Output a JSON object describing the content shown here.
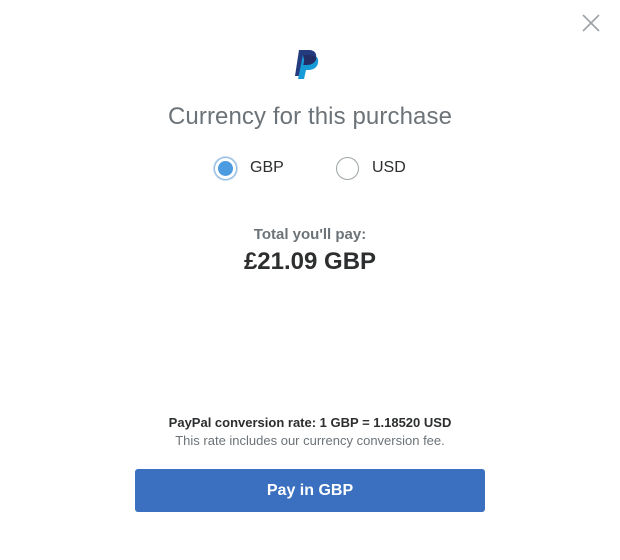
{
  "dialog": {
    "logo_icon": "paypal-logo-icon",
    "close_icon": "close-icon",
    "title": "Currency for this purchase",
    "currency_options": [
      {
        "label": "GBP",
        "selected": true
      },
      {
        "label": "USD",
        "selected": false
      }
    ],
    "total_label": "Total you'll pay:",
    "total_amount": "£21.09 GBP",
    "conversion_rate": "PayPal conversion rate: 1 GBP = 1.18520 USD",
    "fee_note": "This rate includes our currency conversion fee.",
    "pay_button_label": "Pay in GBP"
  },
  "colors": {
    "accent": "#3a70bf",
    "radio_selected": "#4a9be0",
    "muted_text": "#6c7378",
    "body_text": "#2c2e2f"
  }
}
